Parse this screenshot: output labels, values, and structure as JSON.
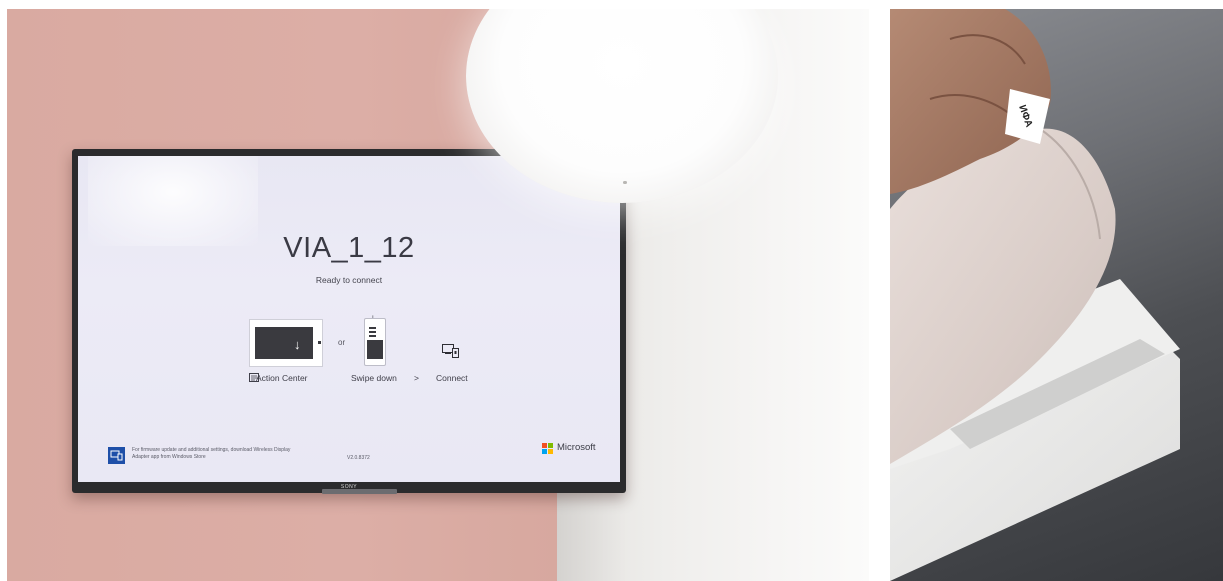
{
  "left_photo": {
    "tv": {
      "device_name": "VIA_1_12",
      "status": "Ready to connect",
      "or_text": "or",
      "steps": {
        "action_center": "Action Center",
        "swipe_down": "Swipe down",
        "arrow": ">",
        "connect": "Connect"
      },
      "footer_line1": "For firmware update and additional settings, download Wireless Display",
      "footer_line2": "Adapter app from Windows Store",
      "version": "V2.0.8372",
      "brand_logo_text": "Microsoft",
      "tv_brand": "SONY"
    }
  },
  "right_photo": {
    "tag_text": "ИФА"
  },
  "colors": {
    "wall_pink": "#d9aaa1",
    "screen_bg": "#e9e8f4",
    "tv_frame": "#2b2b2d",
    "ms_red": "#f25022",
    "ms_green": "#7fba00",
    "ms_blue": "#00a4ef",
    "ms_yellow": "#ffb900"
  },
  "icons": [
    "action-center-icon",
    "phone-swipe-icon",
    "connect-icon",
    "wireless-display-app-icon",
    "microsoft-logo-icon"
  ]
}
